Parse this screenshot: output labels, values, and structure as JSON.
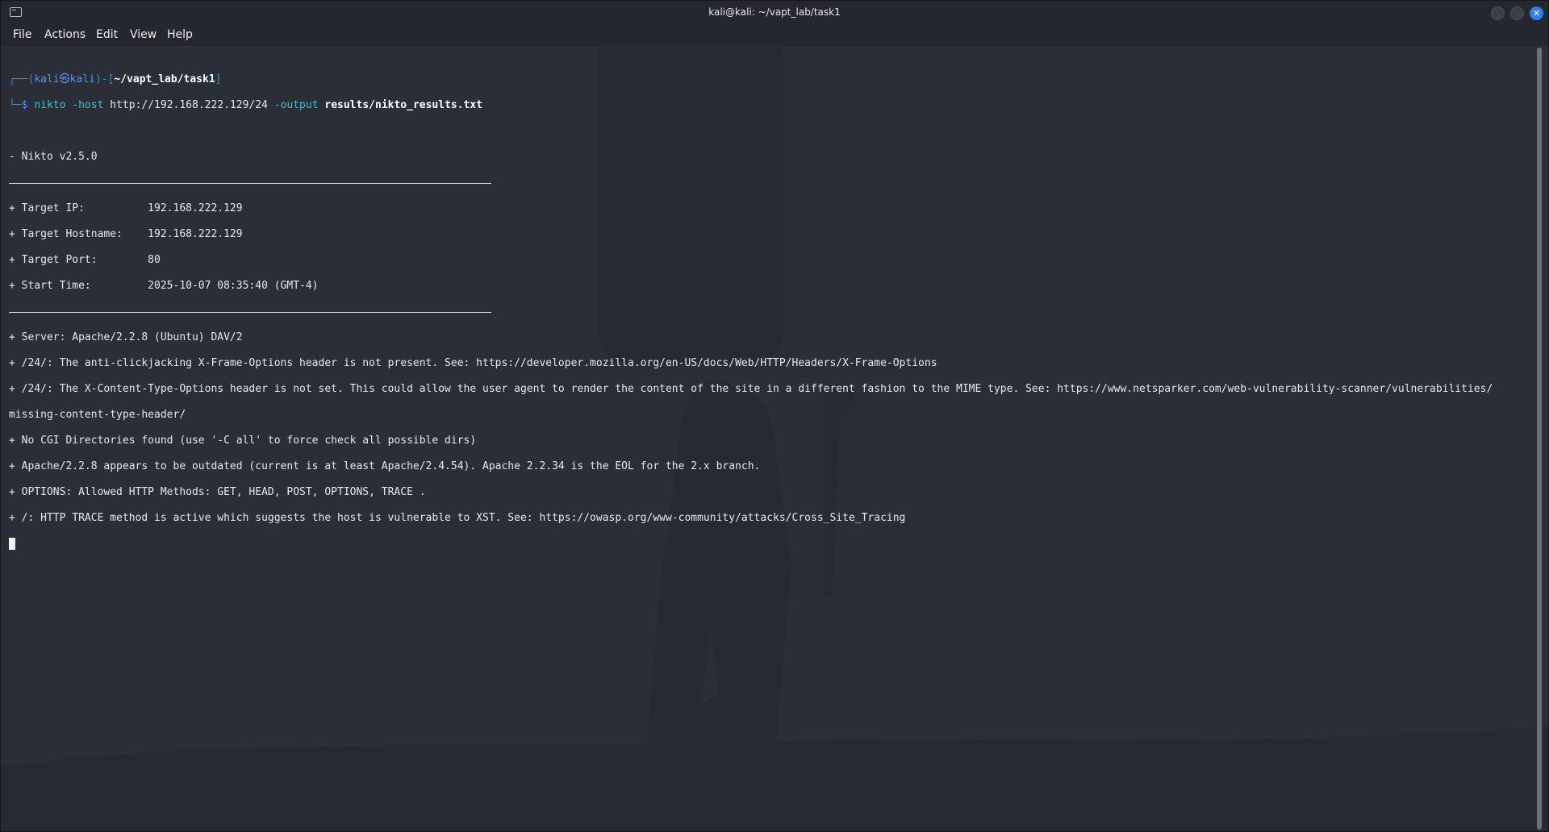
{
  "window": {
    "title": "kali@kali: ~/vapt_lab/task1",
    "close_glyph": "✕"
  },
  "menu": [
    "File",
    "Actions",
    "Edit",
    "View",
    "Help"
  ],
  "prompt": {
    "frame_open": "┌──(",
    "user": "kali㉿kali",
    "frame_mid": ")-[",
    "path": "~/vapt_lab/task1",
    "frame_close": "]",
    "frame_bottom": "└─",
    "symbol": "$ ",
    "cmd": "nikto",
    "arg1": " -host ",
    "target": "http://192.168.222.129/24",
    "arg2": " -output ",
    "outfile": "results/nikto_results.txt"
  },
  "output": {
    "version": "- Nikto v2.5.0",
    "target_ip": "+ Target IP:          192.168.222.129",
    "target_hostname": "+ Target Hostname:    192.168.222.129",
    "target_port": "+ Target Port:        80",
    "start_time": "+ Start Time:         2025-10-07 08:35:40 (GMT-4)",
    "server": "+ Server: Apache/2.2.8 (Ubuntu) DAV/2",
    "xframe": "+ /24/: The anti-clickjacking X-Frame-Options header is not present. See: https://developer.mozilla.org/en-US/docs/Web/HTTP/Headers/X-Frame-Options",
    "xcontent_1": "+ /24/: The X-Content-Type-Options header is not set. This could allow the user agent to render the content of the site in a different fashion to the MIME type. See: https://www.netsparker.com/web-vulnerability-scanner/vulnerabilities/",
    "xcontent_2": "missing-content-type-header/",
    "cgi": "+ No CGI Directories found (use '-C all' to force check all possible dirs)",
    "apache": "+ Apache/2.2.8 appears to be outdated (current is at least Apache/2.4.54). Apache 2.2.34 is the EOL for the 2.x branch.",
    "options": "+ OPTIONS: Allowed HTTP Methods: GET, HEAD, POST, OPTIONS, TRACE .",
    "trace": "+ /: HTTP TRACE method is active which suggests the host is vulnerable to XST. See: https://owasp.org/www-community/attacks/Cross_Site_Tracing"
  },
  "colors": {
    "background": "#2a2e36",
    "titlebar": "#24272d",
    "prompt_frame": "#3a8bd6",
    "command": "#43c2c4",
    "close_button": "#2f7ef0"
  }
}
